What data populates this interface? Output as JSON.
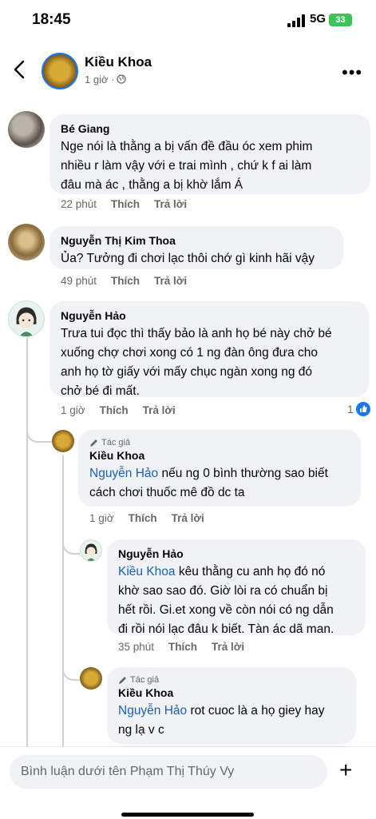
{
  "status": {
    "time": "18:45",
    "network": "5G",
    "battery": "33"
  },
  "post": {
    "author": "Kiều Khoa",
    "time": "1 giờ ·"
  },
  "actions": {
    "like": "Thích",
    "reply": "Trả lời"
  },
  "author_badge": "Tác giả",
  "comments": [
    {
      "name": "Bé Giang",
      "lines": [
        "Nge nói là thằng a bị vấn đề đầu óc xem phim",
        "nhiều r làm vậy với e trai mình , chứ k f ai làm",
        "đâu mà ác , thằng a bị khờ lắm Á"
      ],
      "time": "22 phút"
    },
    {
      "name": "Nguyễn Thị Kim Thoa",
      "lines": [
        "Ủa? Tưởng đi chơi lạc thôi chớ gì kinh hãi vậy"
      ],
      "time": "49 phút"
    },
    {
      "name": "Nguyễn Hảo",
      "lines": [
        "Trưa tui đọc thì thấy bảo là anh họ bé này chở bé",
        "xuống chợ chơi xong có 1 ng đàn ông đưa cho",
        "anh họ tờ giấy với mấy chục ngàn xong ng đó",
        "chở bé đi mất."
      ],
      "time": "1 giờ",
      "reactions": "1"
    }
  ],
  "replies": [
    {
      "name": "Kiều Khoa",
      "mention": "Nguyễn Hảo",
      "line1": " nếu ng 0 bình thường sao biết",
      "lines": [
        "cách chơi thuốc mê đồ dc ta"
      ],
      "time": "1 giờ"
    },
    {
      "name": "Nguyễn Hảo",
      "mention": "Kiều Khoa",
      "line1": "  kêu thằng cu anh họ đó nó",
      "lines": [
        "khờ sao sao đó. Giờ lòi ra có chuẩn bị",
        "hết rồi. Gi.et xong về còn nói có ng dẫn",
        "đi rồi nói lạc đâu k biết. Tàn ác dã man."
      ],
      "time": "35 phút"
    },
    {
      "name": "Kiều Khoa",
      "mention": "Nguyễn Hảo",
      "line1": " rot cuoc là a họ giey hay",
      "lines": [
        "ng lạ v c"
      ]
    }
  ],
  "composer": {
    "placeholder": "Bình luận dưới tên Phạm Thị Thúy Vy"
  },
  "colors": {
    "link": "#1a5fb8",
    "bubble": "#f0f2f5",
    "meta": "#65676b",
    "reaction": "#1877f2"
  }
}
